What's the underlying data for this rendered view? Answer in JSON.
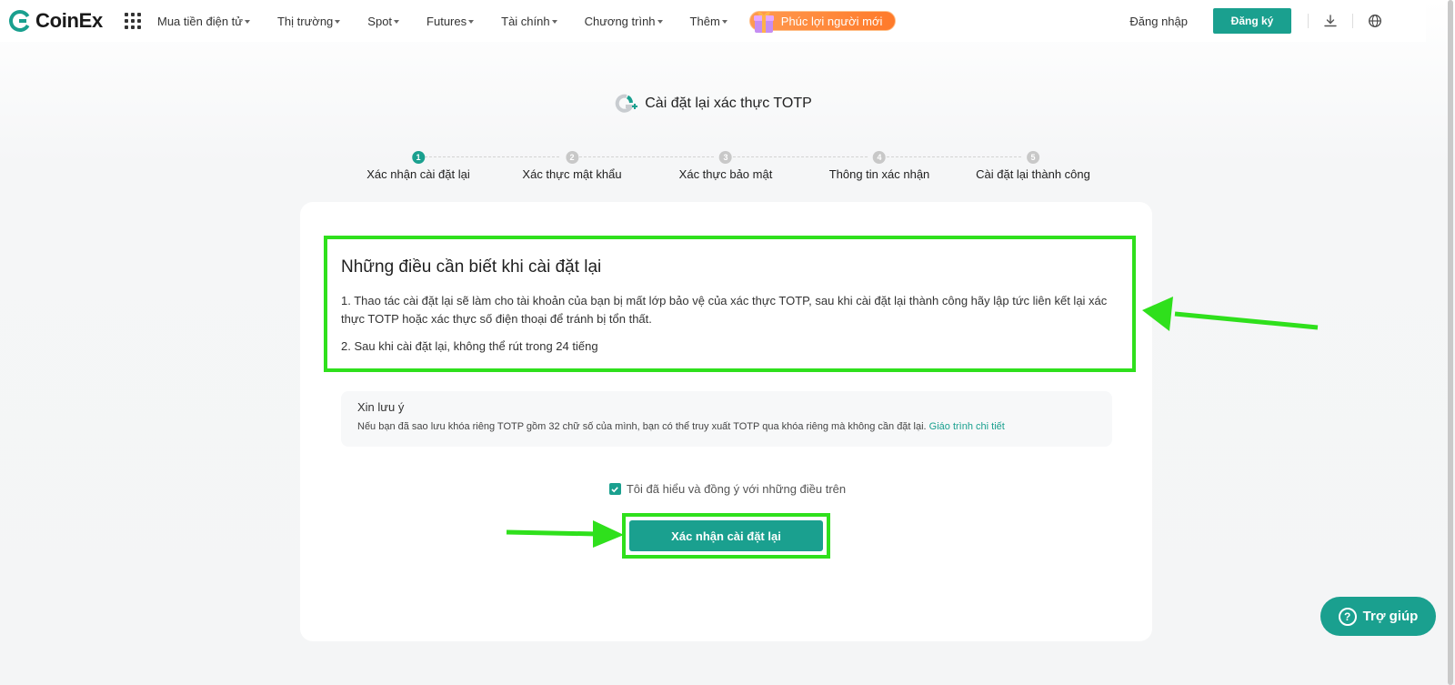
{
  "brand": {
    "name": "CoinEx",
    "accent": "#1aa08f",
    "highlight": "#2fe01c"
  },
  "nav": {
    "items": [
      {
        "label": "Mua tiền điện tử"
      },
      {
        "label": "Thị trường"
      },
      {
        "label": "Spot"
      },
      {
        "label": "Futures"
      },
      {
        "label": "Tài chính"
      },
      {
        "label": "Chương trình"
      },
      {
        "label": "Thêm"
      }
    ],
    "promo_label": "Phúc lợi người mới",
    "login_label": "Đăng nhập",
    "register_label": "Đăng ký"
  },
  "page": {
    "title": "Cài đặt lại xác thực TOTP"
  },
  "steps": [
    {
      "number": "1",
      "label": "Xác nhận cài đặt lại",
      "active": true
    },
    {
      "number": "2",
      "label": "Xác thực mật khẩu",
      "active": false
    },
    {
      "number": "3",
      "label": "Xác thực bảo mật",
      "active": false
    },
    {
      "number": "4",
      "label": "Thông tin xác nhận",
      "active": false
    },
    {
      "number": "5",
      "label": "Cài đặt lại thành công",
      "active": false
    }
  ],
  "notice": {
    "title": "Những điều cần biết khi cài đặt lại",
    "item1": "1. Thao tác cài đặt lại sẽ làm cho tài khoản của bạn bị mất lớp bảo vệ của xác thực TOTP, sau khi cài đặt lại thành công hãy lập tức liên kết lại xác thực TOTP hoặc xác thực số điện thoại để tránh bị tổn thất.",
    "item2": "2. Sau khi cài đặt lại, không thể rút trong 24 tiếng"
  },
  "tip": {
    "title": "Xin lưu ý",
    "text": "Nếu bạn đã sao lưu khóa riêng TOTP gồm 32 chữ số của mình, bạn có thể truy xuất TOTP qua khóa riêng mà không cần đặt lại.",
    "link": "Giáo trình chi tiết"
  },
  "agreement": {
    "label": "Tôi đã hiểu và đồng ý với những điều trên",
    "checked": true
  },
  "confirm_button": "Xác nhận cài đặt lại",
  "help_button": "Trợ giúp"
}
